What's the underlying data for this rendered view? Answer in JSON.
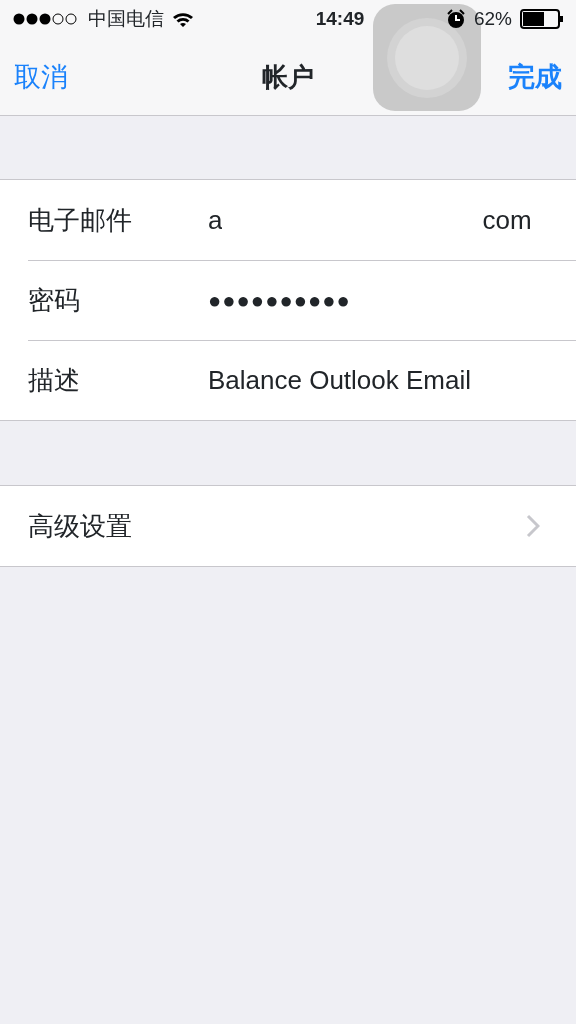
{
  "status_bar": {
    "carrier": "中国电信",
    "time": "14:49",
    "battery": "62%"
  },
  "nav": {
    "left": "取消",
    "title": "帐户",
    "right": "完成"
  },
  "fields": [
    {
      "kind": "redacted",
      "label": "电子邮件",
      "value_start": "a",
      "value_end": "com"
    },
    {
      "kind": "password",
      "label": "密码",
      "value": "●●●●●●●●●●"
    },
    {
      "kind": "text",
      "label": "描述",
      "value": "Balance Outlook Email"
    }
  ],
  "links": [
    {
      "label": "高级设置"
    }
  ]
}
